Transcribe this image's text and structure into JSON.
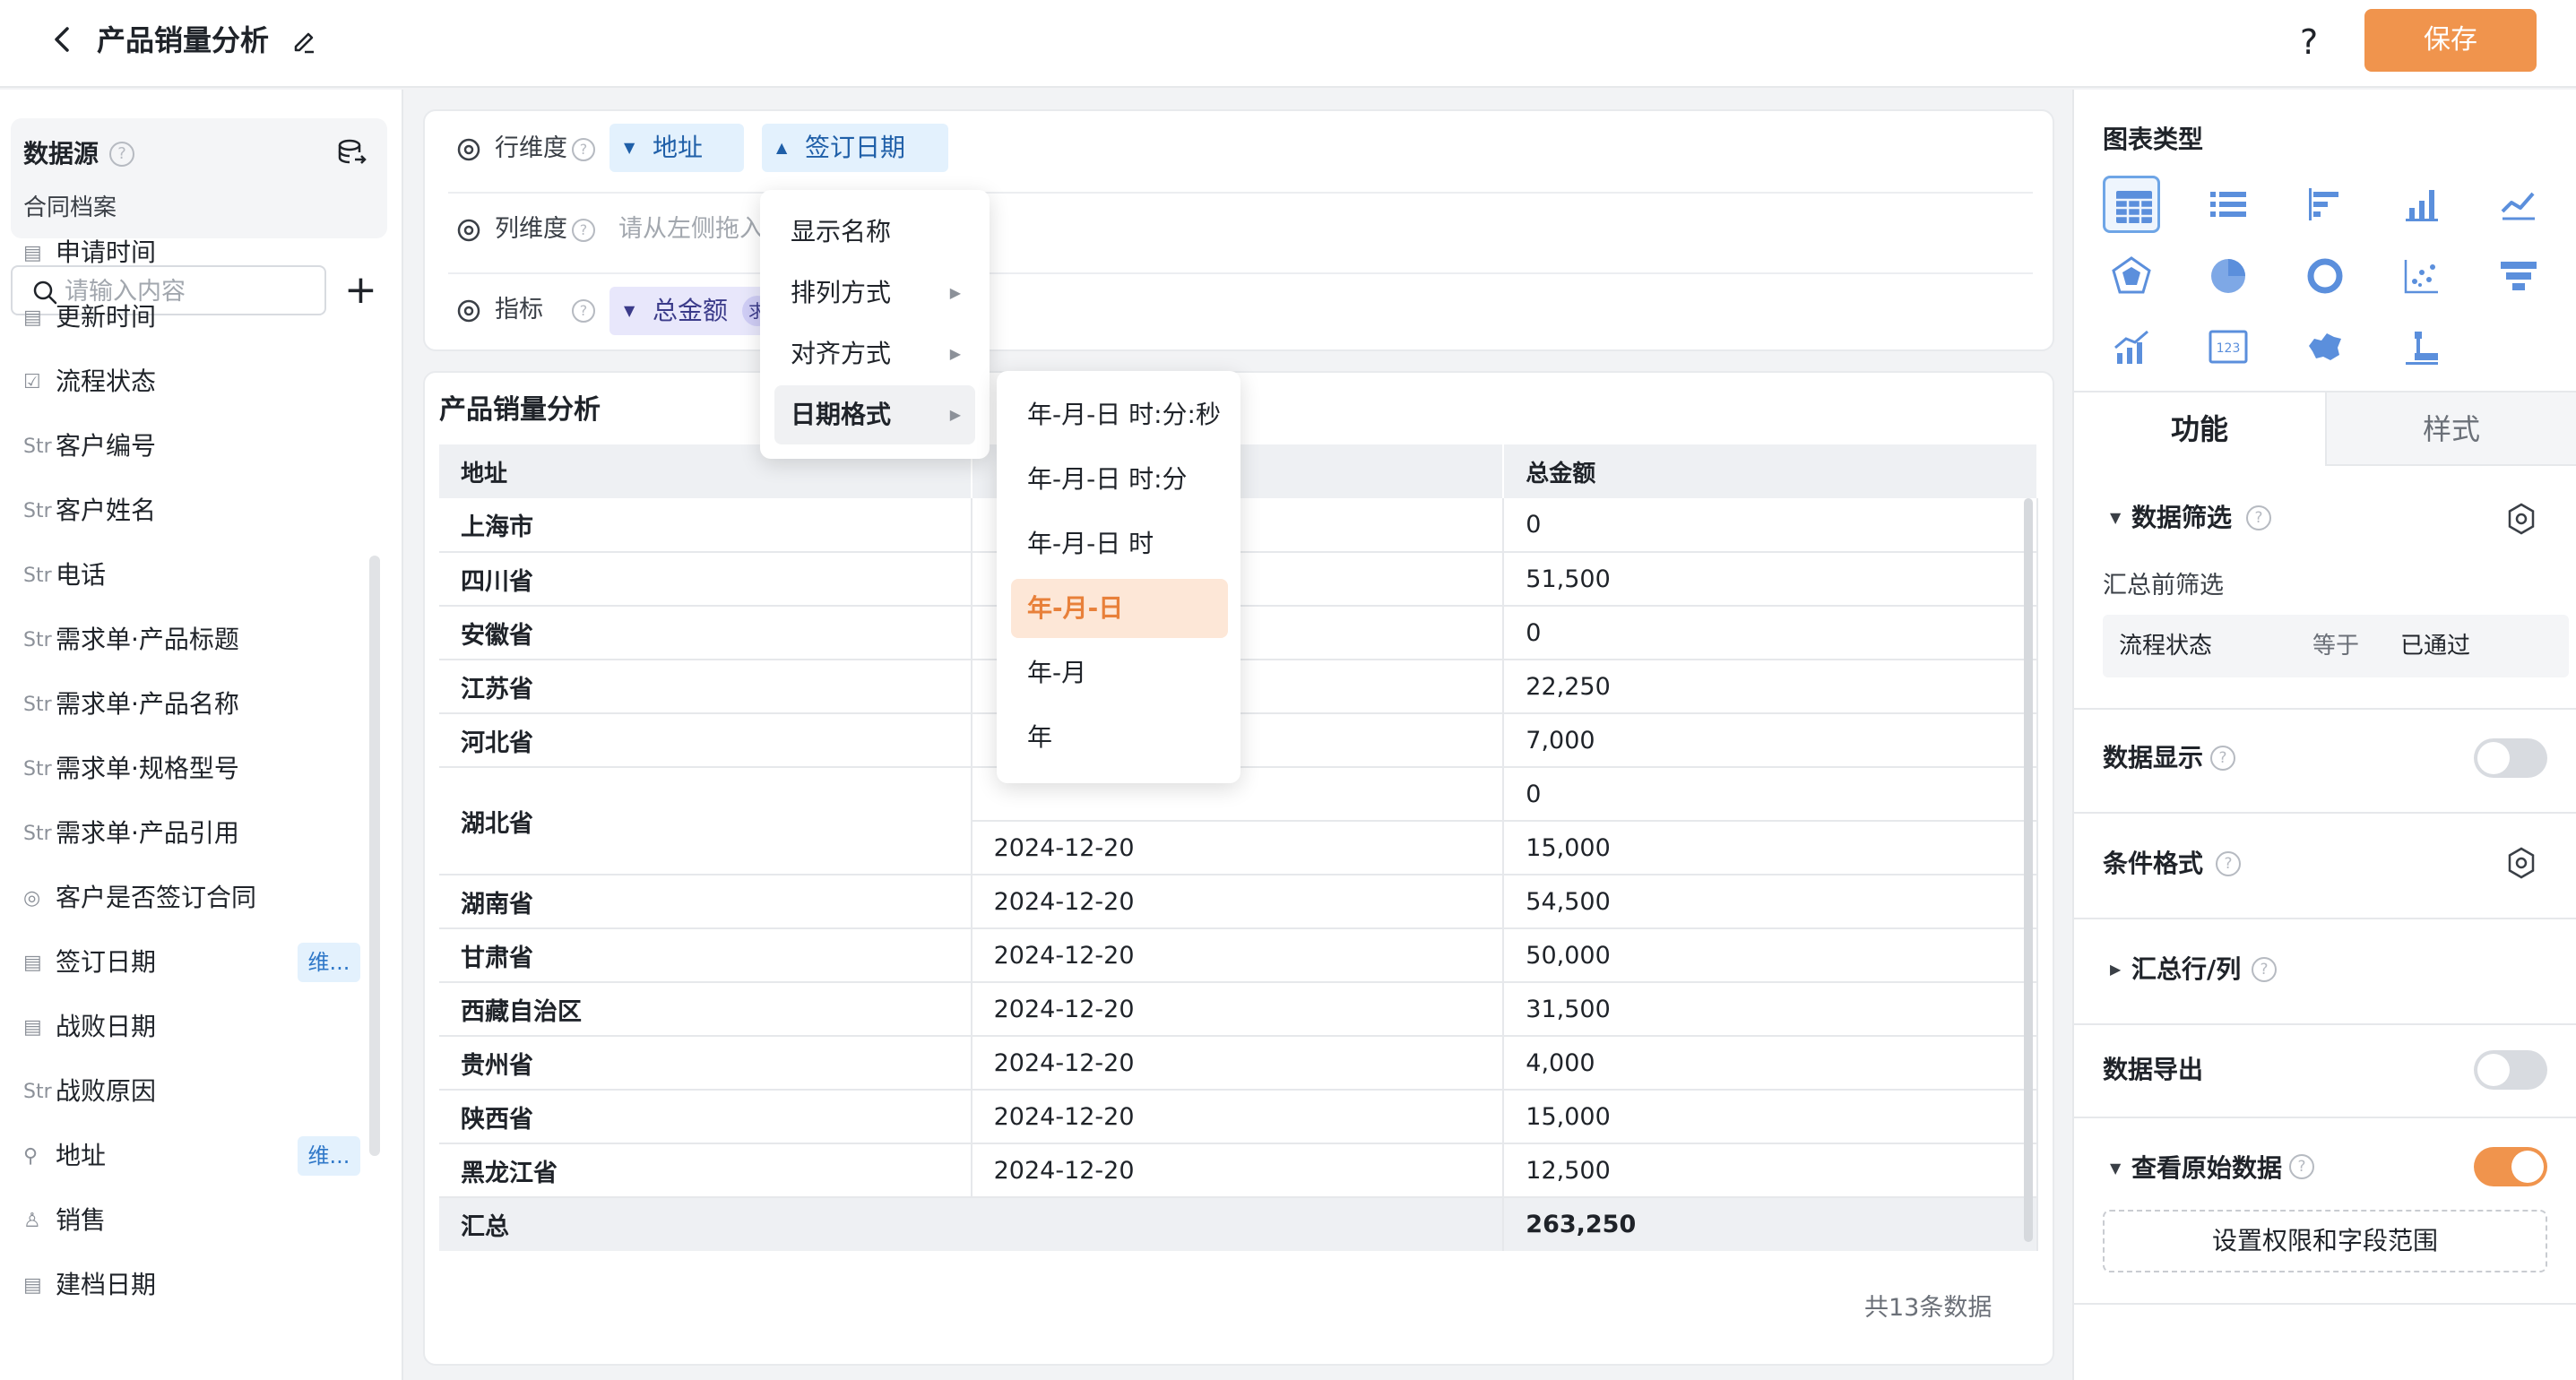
{
  "header": {
    "title": "产品销量分析",
    "save_label": "保存",
    "help": "?"
  },
  "left": {
    "datasource_title": "数据源",
    "datasource_name": "合同档案",
    "search_placeholder": "请输入内容",
    "fields": [
      {
        "icon": "calendar",
        "glyph": "▤",
        "label": "申请时间",
        "tag": ""
      },
      {
        "icon": "calendar",
        "glyph": "▤",
        "label": "更新时间",
        "tag": ""
      },
      {
        "icon": "checkbox",
        "glyph": "☑",
        "label": "流程状态",
        "tag": ""
      },
      {
        "icon": "string",
        "glyph": "Str",
        "label": "客户编号",
        "tag": ""
      },
      {
        "icon": "string",
        "glyph": "Str",
        "label": "客户姓名",
        "tag": ""
      },
      {
        "icon": "string",
        "glyph": "Str",
        "label": "电话",
        "tag": ""
      },
      {
        "icon": "string",
        "glyph": "Str",
        "label": "需求单·产品标题",
        "tag": ""
      },
      {
        "icon": "string",
        "glyph": "Str",
        "label": "需求单·产品名称",
        "tag": ""
      },
      {
        "icon": "string",
        "glyph": "Str",
        "label": "需求单·规格型号",
        "tag": ""
      },
      {
        "icon": "string",
        "glyph": "Str",
        "label": "需求单·产品引用",
        "tag": ""
      },
      {
        "icon": "radio",
        "glyph": "◎",
        "label": "客户是否签订合同",
        "tag": ""
      },
      {
        "icon": "calendar",
        "glyph": "▤",
        "label": "签订日期",
        "tag": "维..."
      },
      {
        "icon": "calendar",
        "glyph": "▤",
        "label": "战败日期",
        "tag": ""
      },
      {
        "icon": "string",
        "glyph": "Str",
        "label": "战败原因",
        "tag": ""
      },
      {
        "icon": "address",
        "glyph": "⚲",
        "label": "地址",
        "tag": "维..."
      },
      {
        "icon": "user",
        "glyph": "♙",
        "label": "销售",
        "tag": ""
      },
      {
        "icon": "calendar",
        "glyph": "▤",
        "label": "建档日期",
        "tag": ""
      }
    ]
  },
  "config": {
    "row_label": "行维度",
    "col_label": "列维度",
    "metric_label": "指标",
    "row_chips": [
      "地址",
      "签订日期"
    ],
    "col_placeholder": "请从左侧拖入",
    "metric_chip": "总金额",
    "metric_chip_sub": "求"
  },
  "menu": {
    "items": [
      "显示名称",
      "排列方式",
      "对齐方式",
      "日期格式"
    ],
    "date_formats": [
      "年-月-日 时:分:秒",
      "年-月-日 时:分",
      "年-月-日 时",
      "年-月-日",
      "年-月",
      "年"
    ]
  },
  "table": {
    "title": "产品销量分析",
    "headers": [
      "地址",
      "",
      "总金额"
    ],
    "rows": [
      {
        "province": "上海市",
        "date": "",
        "amount": "0"
      },
      {
        "province": "四川省",
        "date": "",
        "amount": "51,500"
      },
      {
        "province": "安徽省",
        "date": "",
        "amount": "0"
      },
      {
        "province": "江苏省",
        "date": "",
        "amount": "22,250"
      },
      {
        "province": "河北省",
        "date": "",
        "amount": "7,000"
      },
      {
        "province": "湖北省",
        "date": "",
        "amount": "0"
      },
      {
        "province": "",
        "date": "2024-12-20",
        "amount": "15,000"
      },
      {
        "province": "湖南省",
        "date": "2024-12-20",
        "amount": "54,500"
      },
      {
        "province": "甘肃省",
        "date": "2024-12-20",
        "amount": "50,000"
      },
      {
        "province": "西藏自治区",
        "date": "2024-12-20",
        "amount": "31,500"
      },
      {
        "province": "贵州省",
        "date": "2024-12-20",
        "amount": "4,000"
      },
      {
        "province": "陕西省",
        "date": "2024-12-20",
        "amount": "15,000"
      },
      {
        "province": "黑龙江省",
        "date": "2024-12-20",
        "amount": "12,500"
      }
    ],
    "total_label": "汇总",
    "total_value": "263,250",
    "footer": "共13条数据"
  },
  "right": {
    "chart_type_title": "图表类型",
    "tab_function": "功能",
    "tab_style": "样式",
    "data_filter": "数据筛选",
    "pre_filter": "汇总前筛选",
    "filter": {
      "field": "流程状态",
      "op": "等于",
      "value": "已通过"
    },
    "data_display": "数据显示",
    "cond_format": "条件格式",
    "summary": "汇总行/列",
    "data_export": "数据导出",
    "raw_data": "查看原始数据",
    "perm_button": "设置权限和字段范围",
    "toggles": {
      "data_display": false,
      "data_export": false,
      "raw_data": true
    },
    "accent_color": "#f0944d"
  }
}
